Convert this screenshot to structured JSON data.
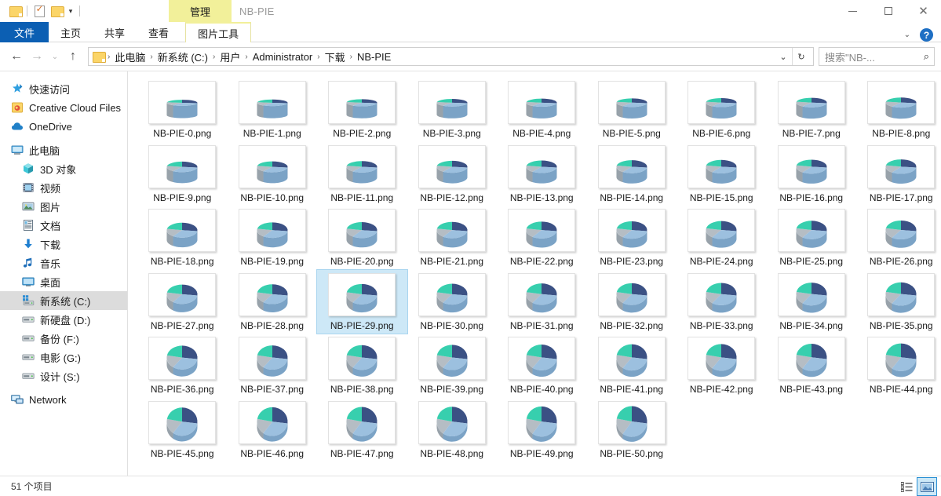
{
  "window": {
    "title": "NB-PIE",
    "context_tab": "管理",
    "minimize_icon": "minimize-icon",
    "maximize_icon": "maximize-icon",
    "close_icon": "close-icon"
  },
  "quick_access": {
    "items": [
      {
        "name": "folder-icon",
        "label": ""
      },
      {
        "name": "properties-icon",
        "label": ""
      },
      {
        "name": "new-folder-icon",
        "label": ""
      },
      {
        "name": "customize-qat-caret",
        "label": "▾"
      }
    ]
  },
  "ribbon": {
    "tabs": [
      {
        "label": "文件",
        "name": "tab-file",
        "kind": "file"
      },
      {
        "label": "主页",
        "name": "tab-home",
        "kind": "normal"
      },
      {
        "label": "共享",
        "name": "tab-share",
        "kind": "normal"
      },
      {
        "label": "查看",
        "name": "tab-view",
        "kind": "normal"
      },
      {
        "label": "图片工具",
        "name": "tab-picture-tools",
        "kind": "ctx"
      }
    ],
    "collapse_caret": "⌄",
    "help_label": "?"
  },
  "address": {
    "back_icon": "←",
    "forward_icon": "→",
    "recent_icon": "⌄",
    "up_icon": "↑",
    "crumbs": [
      "此电脑",
      "新系统 (C:)",
      "用户",
      "Administrator",
      "下载",
      "NB-PIE"
    ],
    "separator": "›",
    "dropdown_icon": "⌄",
    "refresh_icon": "↻"
  },
  "search": {
    "placeholder": "搜索\"NB-...",
    "icon": "search-icon"
  },
  "sidebar": {
    "items": [
      {
        "label": "快速访问",
        "name": "sidebar-item-quick-access",
        "icon": "star-pin-icon",
        "indent": false,
        "selected": false
      },
      {
        "label": "Creative Cloud Files",
        "name": "sidebar-item-creative-cloud-files",
        "icon": "creative-cloud-icon",
        "indent": false,
        "selected": false
      },
      {
        "label": "OneDrive",
        "name": "sidebar-item-onedrive",
        "icon": "cloud-icon",
        "indent": false,
        "selected": false
      },
      {
        "label": "此电脑",
        "name": "sidebar-item-this-pc",
        "icon": "monitor-icon",
        "indent": false,
        "selected": false
      },
      {
        "label": "3D 对象",
        "name": "sidebar-item-3d-objects",
        "icon": "cube-icon",
        "indent": true,
        "selected": false
      },
      {
        "label": "视频",
        "name": "sidebar-item-videos",
        "icon": "film-icon",
        "indent": true,
        "selected": false
      },
      {
        "label": "图片",
        "name": "sidebar-item-pictures",
        "icon": "picture-icon",
        "indent": true,
        "selected": false
      },
      {
        "label": "文档",
        "name": "sidebar-item-documents",
        "icon": "document-icon",
        "indent": true,
        "selected": false
      },
      {
        "label": "下载",
        "name": "sidebar-item-downloads",
        "icon": "download-arrow-icon",
        "indent": true,
        "selected": false
      },
      {
        "label": "音乐",
        "name": "sidebar-item-music",
        "icon": "music-note-icon",
        "indent": true,
        "selected": false
      },
      {
        "label": "桌面",
        "name": "sidebar-item-desktop",
        "icon": "desktop-icon",
        "indent": true,
        "selected": false
      },
      {
        "label": "新系统 (C:)",
        "name": "sidebar-item-drive-c",
        "icon": "system-drive-icon",
        "indent": true,
        "selected": true
      },
      {
        "label": "新硬盘 (D:)",
        "name": "sidebar-item-drive-d",
        "icon": "drive-icon",
        "indent": true,
        "selected": false
      },
      {
        "label": "备份 (F:)",
        "name": "sidebar-item-drive-f",
        "icon": "drive-icon",
        "indent": true,
        "selected": false
      },
      {
        "label": "电影 (G:)",
        "name": "sidebar-item-drive-g",
        "icon": "drive-icon",
        "indent": true,
        "selected": false
      },
      {
        "label": "设计 (S:)",
        "name": "sidebar-item-drive-s",
        "icon": "drive-icon",
        "indent": true,
        "selected": false
      },
      {
        "label": "Network",
        "name": "sidebar-item-network",
        "icon": "network-icon",
        "indent": false,
        "selected": false
      }
    ]
  },
  "files": {
    "selected_index": 29,
    "count": 51,
    "names": [
      "NB-PIE-0.png",
      "NB-PIE-1.png",
      "NB-PIE-2.png",
      "NB-PIE-3.png",
      "NB-PIE-4.png",
      "NB-PIE-5.png",
      "NB-PIE-6.png",
      "NB-PIE-7.png",
      "NB-PIE-8.png",
      "NB-PIE-9.png",
      "NB-PIE-10.png",
      "NB-PIE-11.png",
      "NB-PIE-12.png",
      "NB-PIE-13.png",
      "NB-PIE-14.png",
      "NB-PIE-15.png",
      "NB-PIE-16.png",
      "NB-PIE-17.png",
      "NB-PIE-18.png",
      "NB-PIE-19.png",
      "NB-PIE-20.png",
      "NB-PIE-21.png",
      "NB-PIE-22.png",
      "NB-PIE-23.png",
      "NB-PIE-24.png",
      "NB-PIE-25.png",
      "NB-PIE-26.png",
      "NB-PIE-27.png",
      "NB-PIE-28.png",
      "NB-PIE-29.png",
      "NB-PIE-30.png",
      "NB-PIE-31.png",
      "NB-PIE-32.png",
      "NB-PIE-33.png",
      "NB-PIE-34.png",
      "NB-PIE-35.png",
      "NB-PIE-36.png",
      "NB-PIE-37.png",
      "NB-PIE-38.png",
      "NB-PIE-39.png",
      "NB-PIE-40.png",
      "NB-PIE-41.png",
      "NB-PIE-42.png",
      "NB-PIE-43.png",
      "NB-PIE-44.png",
      "NB-PIE-45.png",
      "NB-PIE-46.png",
      "NB-PIE-47.png",
      "NB-PIE-48.png",
      "NB-PIE-49.png",
      "NB-PIE-50.png"
    ]
  },
  "thumbnail_chart": {
    "type": "pie",
    "note": "Each thumbnail shows a 3D pie chart; the viewing tilt rotates from near-vertical (index 0) toward flat/top-down (index 50).",
    "slice_colors": [
      "#3b5184",
      "#9cc0df",
      "#b5bdc4",
      "#37cfae"
    ],
    "slice_fractions": [
      0.27,
      0.33,
      0.18,
      0.22
    ],
    "side_colors": [
      "#2f4269",
      "#7ba3c6",
      "#98a2aa",
      "#2aa98e"
    ]
  },
  "status": {
    "item_count_label": "51 个项目"
  },
  "view_toggles": [
    {
      "name": "details-view-button",
      "icon": "list-view-icon",
      "active": false
    },
    {
      "name": "large-icons-view-button",
      "icon": "thumbnail-view-icon",
      "active": true
    }
  ]
}
